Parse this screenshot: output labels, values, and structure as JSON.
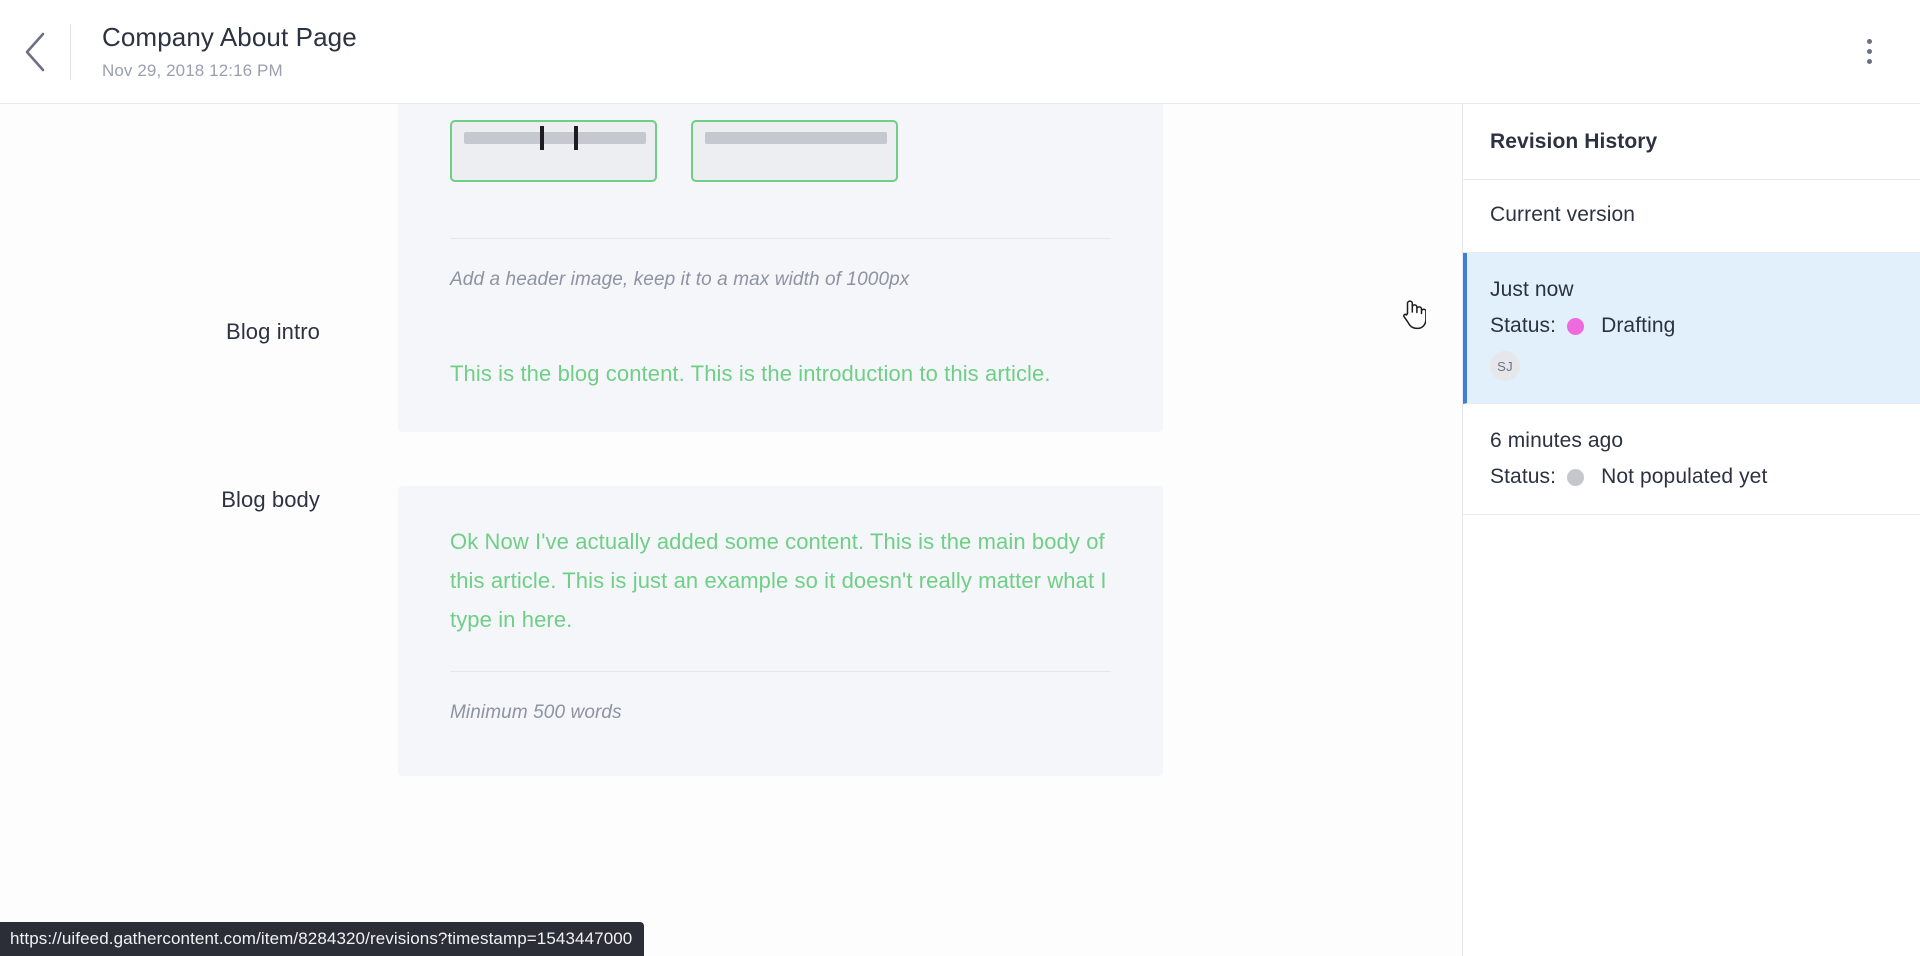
{
  "header": {
    "back_icon": "chevron-left-icon",
    "title": "Company About Page",
    "subtitle": "Nov 29, 2018 12:16 PM",
    "menu_icon": "more-vertical-icon"
  },
  "main": {
    "header_image_field": {
      "hint": "Add a header image, keep it to a max width of 1000px"
    },
    "fields": [
      {
        "label": "Blog intro",
        "value": "This is the blog content. This is the introduction to this article.",
        "hint": ""
      },
      {
        "label": "Blog body",
        "value": "Ok Now I've actually added some content. This is the main body of this article. This is just an example so it doesn't really matter what I type in here.",
        "hint": "Minimum 500 words"
      }
    ]
  },
  "sidebar": {
    "title": "Revision History",
    "revisions": [
      {
        "time": "Current version",
        "status_label": "",
        "status_value": "",
        "status_color": "",
        "avatar": "",
        "selected": false
      },
      {
        "time": "Just now",
        "status_label": "Status:",
        "status_value": "Drafting",
        "status_color": "#ee6ade",
        "avatar": "SJ",
        "selected": true
      },
      {
        "time": "6 minutes ago",
        "status_label": "Status:",
        "status_value": "Not populated yet",
        "status_color": "#c6c7cc",
        "avatar": "",
        "selected": false
      }
    ]
  },
  "statusbar": {
    "url": "https://uifeed.gathercontent.com/item/8284320/revisions?timestamp=1543447000"
  },
  "colors": {
    "content_green": "#6fcf86",
    "accent_blue": "#3f7fd4",
    "selected_bg": "#e2f0fb",
    "status_pink": "#ee6ade",
    "status_gray": "#c6c7cc"
  }
}
